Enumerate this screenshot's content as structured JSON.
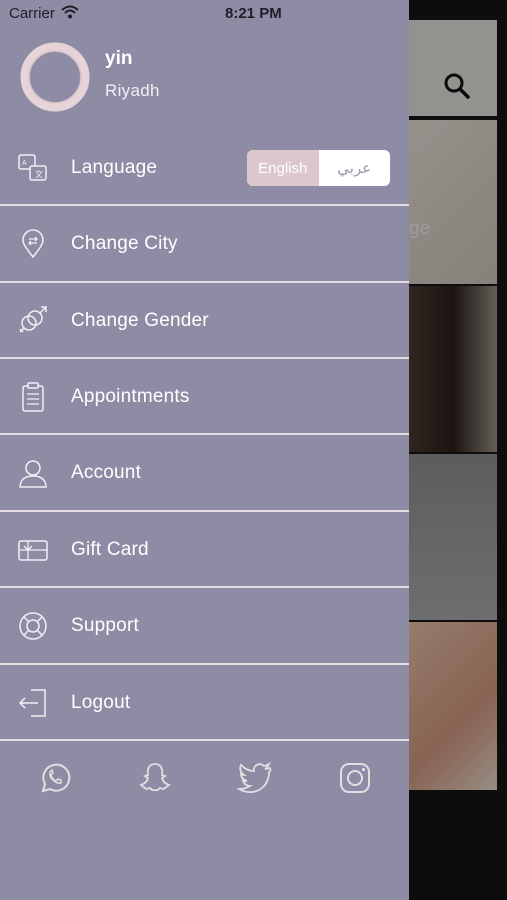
{
  "status_bar": {
    "carrier": "Carrier",
    "time": "8:21 PM"
  },
  "profile": {
    "name": "yin",
    "city": "Riyadh"
  },
  "language": {
    "label": "Language",
    "options": [
      "English",
      "عربي"
    ],
    "selected": "English"
  },
  "menu": {
    "change_city": "Change City",
    "change_gender": "Change Gender",
    "appointments": "Appointments",
    "account": "Account",
    "gift_card": "Gift Card",
    "support": "Support",
    "logout": "Logout"
  },
  "background": {
    "card_text_fragment": "ge"
  },
  "social": [
    "whatsapp-icon",
    "snapchat-icon",
    "twitter-icon",
    "instagram-icon"
  ],
  "colors": {
    "drawer_bg": "#8e8ca5",
    "divider": "#e6dde2",
    "accent_pink": "#dcc7cd",
    "text": "#ffffff"
  }
}
